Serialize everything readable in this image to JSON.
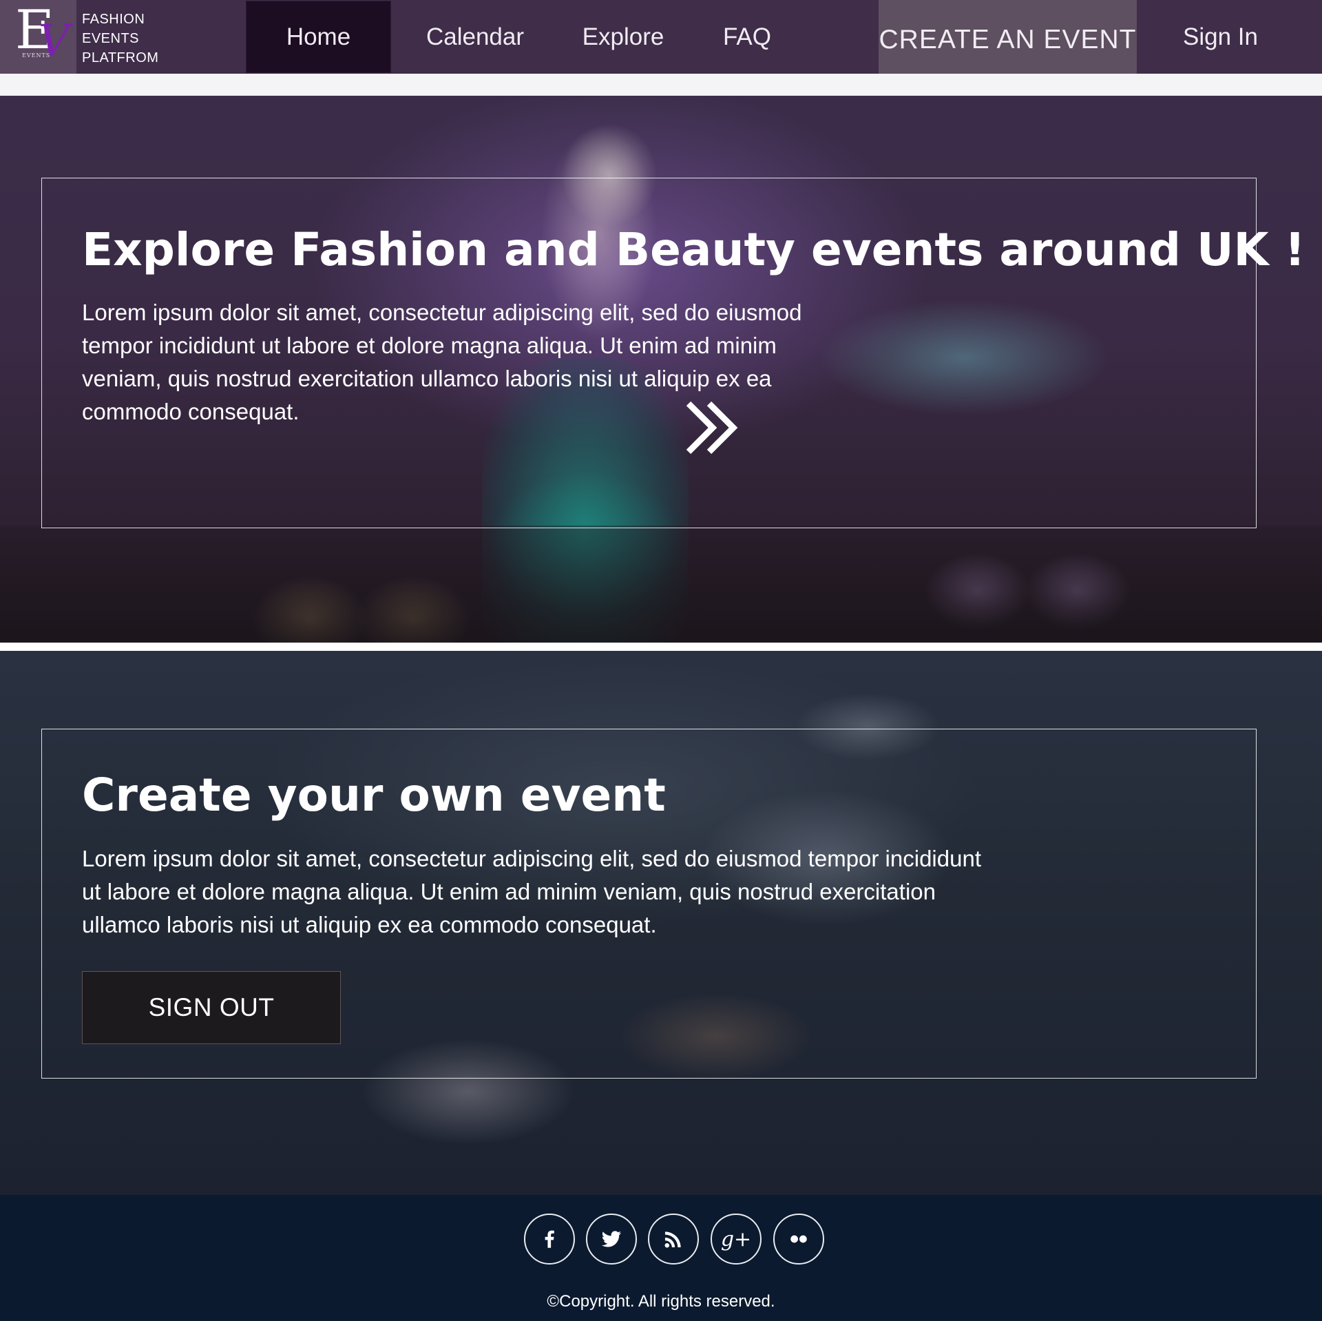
{
  "navbar": {
    "logo": {
      "mark_big": "E",
      "mark_accent": "V",
      "mark_small": "EVENTS"
    },
    "brand_lines": [
      "FASHION",
      "EVENTS",
      "PLATFROM"
    ],
    "items": [
      {
        "label": "Home",
        "active": true
      },
      {
        "label": "Calendar"
      },
      {
        "label": "Explore"
      },
      {
        "label": "FAQ"
      }
    ],
    "create_label": "CREATE AN EVENT",
    "signin_label": "Sign In"
  },
  "hero1": {
    "title": "Explore Fashion and Beauty events around UK ! !",
    "text": "Lorem ipsum dolor sit amet, consectetur adipiscing elit, sed do eiusmod tempor incididunt ut labore et dolore magna aliqua. Ut enim ad minim veniam, quis nostrud exercitation ullamco laboris nisi ut aliquip ex ea commodo consequat.",
    "arrow_icon": "double-chevron-right-icon"
  },
  "hero2": {
    "title": "Create your own event",
    "text": "Lorem ipsum dolor sit amet, consectetur adipiscing elit, sed do eiusmod tempor incididunt ut labore et dolore magna aliqua. Ut enim ad minim veniam, quis nostrud exercitation ullamco laboris nisi ut aliquip ex ea commodo consequat.",
    "button_label": "SIGN OUT"
  },
  "footer": {
    "social_icons": [
      "facebook-icon",
      "twitter-icon",
      "rss-icon",
      "google-plus-icon",
      "flickr-icon"
    ],
    "google_plus_glyph": "g+",
    "copyright": "©Copyright. All rights reserved."
  },
  "colors": {
    "navbar_bg": "#3f2d49",
    "nav_active_bg": "#1d0d23",
    "create_bg": "#5e5060",
    "logo_accent": "#7d1fb0",
    "footer_bg": "#0c1a2f",
    "button_bg": "#1c1a1c"
  }
}
